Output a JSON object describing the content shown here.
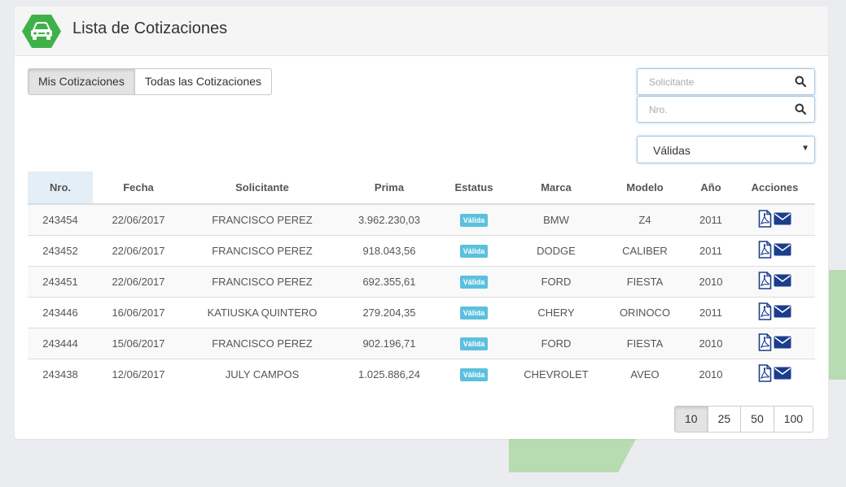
{
  "header": {
    "title": "Lista de Cotizaciones",
    "icon": "car-icon",
    "icon_color": "#3eb249"
  },
  "toggle": {
    "mine_label": "Mis Cotizaciones",
    "all_label": "Todas las Cotizaciones",
    "active": "mine"
  },
  "search": {
    "solicitante_placeholder": "Solicitante",
    "nro_placeholder": "Nro."
  },
  "filter": {
    "selected": "Válidas"
  },
  "table": {
    "columns": [
      "Nro.",
      "Fecha",
      "Solicitante",
      "Prima",
      "Estatus",
      "Marca",
      "Modelo",
      "Año",
      "Acciones"
    ],
    "rows": [
      {
        "nro": "243454",
        "fecha": "22/06/2017",
        "solicitante": "FRANCISCO PEREZ",
        "prima": "3.962.230,03",
        "estatus": "Válida",
        "marca": "BMW",
        "modelo": "Z4",
        "anio": "2011"
      },
      {
        "nro": "243452",
        "fecha": "22/06/2017",
        "solicitante": "FRANCISCO PEREZ",
        "prima": "918.043,56",
        "estatus": "Válida",
        "marca": "DODGE",
        "modelo": "CALIBER",
        "anio": "2011"
      },
      {
        "nro": "243451",
        "fecha": "22/06/2017",
        "solicitante": "FRANCISCO PEREZ",
        "prima": "692.355,61",
        "estatus": "Válida",
        "marca": "FORD",
        "modelo": "FIESTA",
        "anio": "2010"
      },
      {
        "nro": "243446",
        "fecha": "16/06/2017",
        "solicitante": "KATIUSKA QUINTERO",
        "prima": "279.204,35",
        "estatus": "Válida",
        "marca": "CHERY",
        "modelo": "ORINOCO",
        "anio": "2011"
      },
      {
        "nro": "243444",
        "fecha": "15/06/2017",
        "solicitante": "FRANCISCO PEREZ",
        "prima": "902.196,71",
        "estatus": "Válida",
        "marca": "FORD",
        "modelo": "FIESTA",
        "anio": "2010"
      },
      {
        "nro": "243438",
        "fecha": "12/06/2017",
        "solicitante": "JULY CAMPOS",
        "prima": "1.025.886,24",
        "estatus": "Válida",
        "marca": "CHEVROLET",
        "modelo": "AVEO",
        "anio": "2010"
      }
    ]
  },
  "pagination": {
    "sizes": [
      "10",
      "25",
      "50",
      "100"
    ],
    "active": "10"
  },
  "colors": {
    "badge": "#5bc0de",
    "action_icons": "#1a3e8c",
    "accent_green": "#3eb249"
  }
}
